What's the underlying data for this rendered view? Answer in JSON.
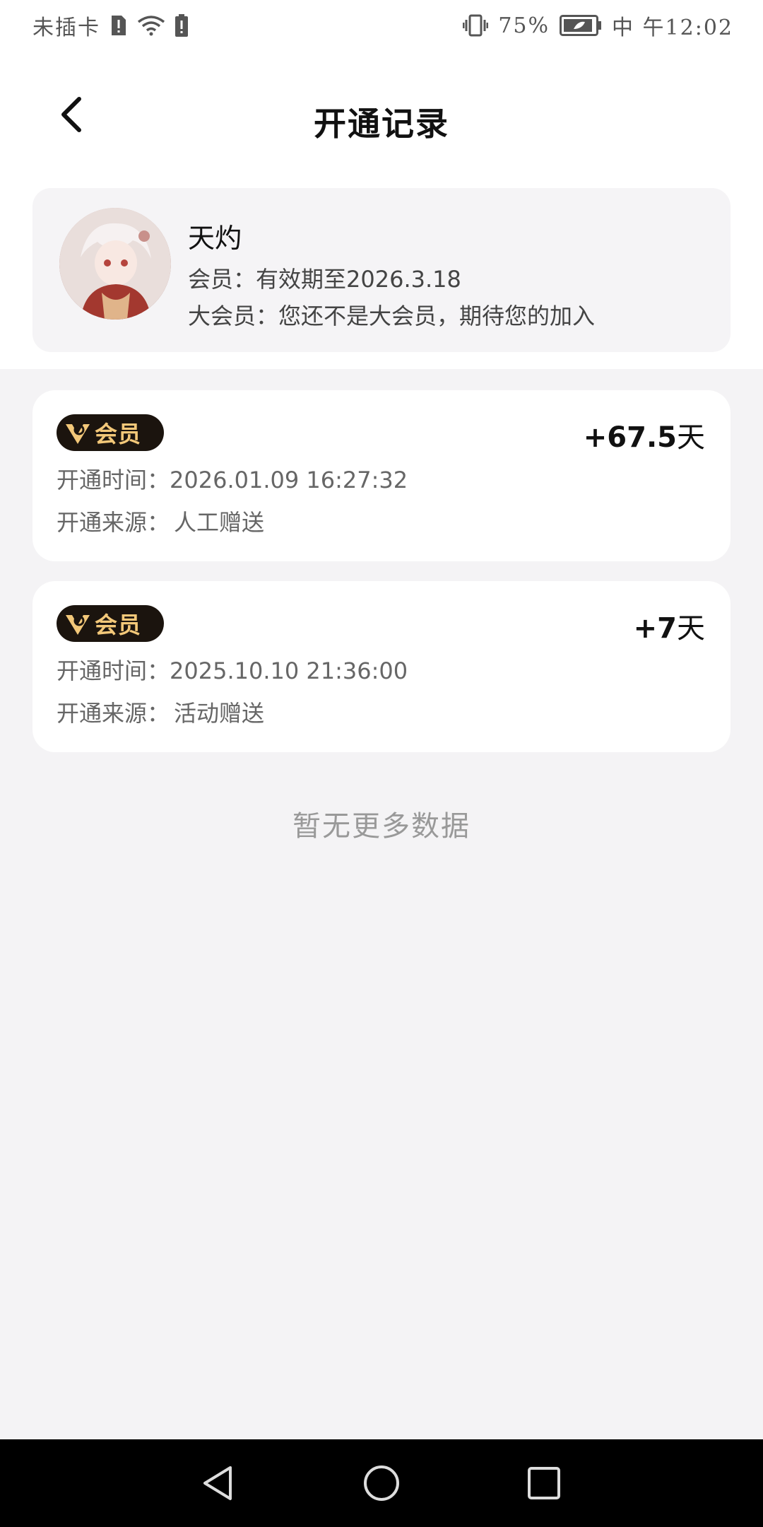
{
  "status_bar": {
    "carrier": "未插卡",
    "battery_percent": "75%",
    "time": "中 午12:02"
  },
  "header": {
    "title": "开通记录"
  },
  "profile": {
    "name": "天灼",
    "member_line": "会员：有效期至2026.3.18",
    "big_member_line": "大会员：您还不是大会员，期待您的加入"
  },
  "records": [
    {
      "badge": "会员",
      "days_value": "+67.5",
      "days_unit": "天",
      "time_label": "开通时间：",
      "time_value": "2026.01.09 16:27:32",
      "source_label": "开通来源：",
      "source_value": "人工赠送"
    },
    {
      "badge": "会员",
      "days_value": "+7",
      "days_unit": "天",
      "time_label": "开通时间：",
      "time_value": "2025.10.10 21:36:00",
      "source_label": "开通来源：",
      "source_value": "活动赠送"
    }
  ],
  "footer": {
    "no_more": "暂无更多数据"
  },
  "colors": {
    "badge_bg": "#1b140e",
    "badge_text": "#f3c879",
    "page_bg": "#f4f3f5"
  }
}
